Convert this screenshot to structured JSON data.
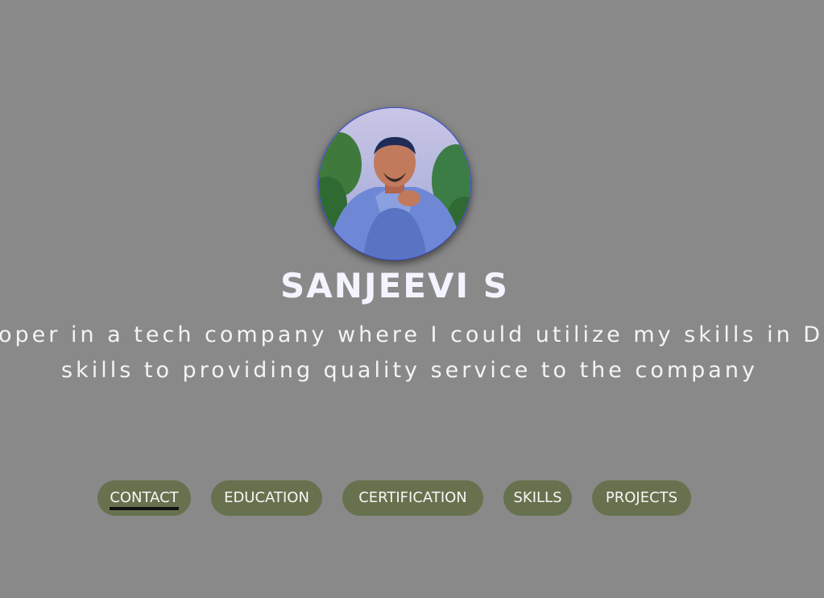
{
  "profile": {
    "name": "SANJEEVI S",
    "avatar_icon": "profile-photo",
    "tagline_line1": "oper in a tech company where I could utilize my skills in Deve",
    "tagline_line2": "skills to providing quality service to the company"
  },
  "nav": {
    "items": [
      {
        "label": "CONTACT",
        "active": true
      },
      {
        "label": "EDUCATION",
        "active": false
      },
      {
        "label": "CERTIFICATION",
        "active": false
      },
      {
        "label": "SKILLS",
        "active": false
      },
      {
        "label": "PROJECTS",
        "active": false
      }
    ]
  },
  "colors": {
    "background": "#898989",
    "button": "#67714e",
    "text": "#f4f4f4",
    "avatar_border": "#3a49d8"
  }
}
